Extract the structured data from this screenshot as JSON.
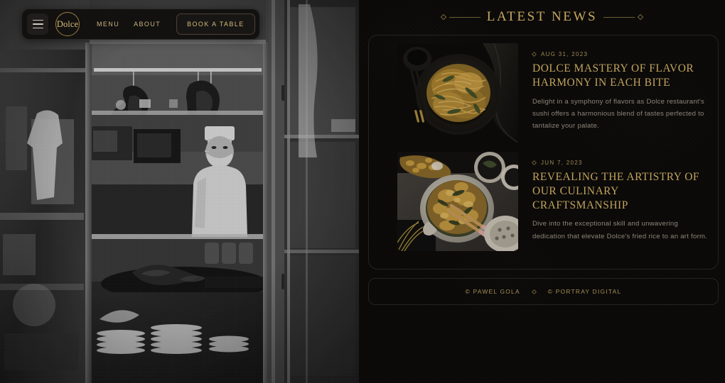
{
  "navbar": {
    "menu_icon": "hamburger-icon",
    "logo_text": "Dolce",
    "links": [
      {
        "label": "MENU"
      },
      {
        "label": "ABOUT"
      }
    ],
    "cta_label": "BOOK A TABLE"
  },
  "hero": {
    "alt": "black and white photograph of a chef in a restaurant kitchen window with hanging roast ducks and stacked plates"
  },
  "news": {
    "section_title": "LATEST NEWS",
    "articles": [
      {
        "date": "AUG 31, 2023",
        "title": "DOLCE MASTERY OF FLAVOR HARMONY IN EACH BITE",
        "excerpt": "Delight in a symphony of flavors as Dolce restaurant's sushi offers a harmonious blend of tastes perfected to tantalize your palate.",
        "image_alt": "overhead shot of stir-fried noodles on a dark plate with chopsticks"
      },
      {
        "date": "JUN 7, 2023",
        "title": "REVEALING THE ARTISTRY OF OUR CULINARY CRAFTSMANSHIP",
        "excerpt": "Dive into the exceptional skill and unwavering dedication that elevate Dolce's fried rice to an art form.",
        "image_alt": "overhead shot of a bowl of fried rice with chopsticks and side dishes"
      }
    ]
  },
  "footer": {
    "credits": [
      {
        "label": "© PAWEL GOLA"
      },
      {
        "label": "© PORTRAY DIGITAL"
      }
    ]
  },
  "colors": {
    "gold": "#c6a75f",
    "gold_dim": "#a78f53",
    "body_text": "#8e8578",
    "background": "#0b0a09",
    "border": "#262320"
  }
}
